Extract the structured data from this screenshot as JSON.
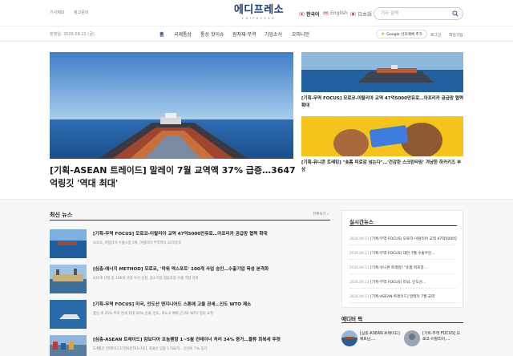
{
  "header": {
    "top_links": [
      "기사제보",
      "광고문의"
    ],
    "logo_text": "에디프레소",
    "logo_sub": "EDIPRESSO",
    "languages": [
      {
        "label": "한국어",
        "active": true
      },
      {
        "label": "English",
        "active": false
      },
      {
        "label": "日本語",
        "active": false
      }
    ],
    "search_placeholder": "기사 검색"
  },
  "nav": {
    "date": "발행일: 2026.09.11 (금)",
    "items": [
      "홈",
      "국제통상",
      "통상 핫이슈",
      "원자재·무역",
      "기업소식",
      "오피니언"
    ],
    "active_index": 0,
    "google_button": "Google 선호매체 추가",
    "util_links": [
      "로그인",
      "회원가입"
    ]
  },
  "featured": {
    "title": "[기획-ASEAN 트레이드] 말레이 7월 교역액 37% 급증…3647억링깃 '역대 최대'",
    "side_articles": [
      {
        "title": "[기획-무역 FOCUS] 모로코-이탈리아 교역 47억5000만유로…아프리카 공급망 협력 확대"
      },
      {
        "title": "[기획-유니콘 트래킹] \"숏폼 피로감 넘는다\"…'건강한 스크린타임' 겨냥한 하카키즈 부상"
      }
    ]
  },
  "latest": {
    "heading": "최신 뉴스",
    "view_all": "전체보기 ›",
    "items": [
      {
        "title": "[기획-무역 FOCUS] 모로코-이탈리아 교역 47억5000만유로…아프리카 공급망 협력 확대",
        "sub": "모로코, 이탈리아 수출시장 5위, 이탈리아 무역흑자 12억유로"
      },
      {
        "title": "[심층-에너지 METHOD] 모로코, '파워 엑스포트' 100개 사업 승인…수출기업 육성 본격화",
        "sub": "435개 신청 중 100개 사업 우선 선정, 중소기업 협동조합 수출 역량 강화"
      },
      {
        "title": "[기획-무역 FOCUS] 미국, 인도산 엔지니어드 스톤에 고율 관세…인도 WTO 제소",
        "sub": "활당 세 25%·추과 관세 최대 50% 관세, 인도, 개도국 예외 근거로 WTO 협의 요청"
      },
      {
        "title": "[심층-ASEAN 트레이드] 캄보디아 프놈펜항 1~5월 컨테이너 처리 34% 증가…물류 회복세 뚜렷",
        "sub": "5개월간 컨테이너 27만6천TEU 처리, 화물선 입항 1,582척…전년비 7% 증가"
      }
    ]
  },
  "realtime": {
    "heading": "실시간뉴스",
    "items": [
      {
        "date": "2026.09.11",
        "title": "[기획-무역 FOCUS] 모로코-이탈리아 교역 47억5000만유로"
      },
      {
        "date": "2026.09.11",
        "title": "[기획-무역 FOCUS] 대만 7월 수출주문…"
      },
      {
        "date": "2026.09.11",
        "title": "[기획-유니콘 트래킹] \"숏폼 피로감…"
      },
      {
        "date": "2026.09.11",
        "title": "[기획-무역 FOCUS] 미국, 인도산…"
      },
      {
        "date": "2026.09.11",
        "title": "[기획-ASEAN 트레이드] 말레이 7월 교역"
      }
    ]
  },
  "editors_pick": {
    "heading": "에디터 픽",
    "items": [
      {
        "title": "[심층-ASEAN 트레이드] 베트남,…"
      },
      {
        "title": "[기획-무역 FOCUS] 모로코-이탈리아,…"
      }
    ]
  },
  "colors": {
    "brand": "#1a3a7a",
    "accent_yellow": "#f3c40f",
    "sea_blue": "#2b6cae"
  }
}
